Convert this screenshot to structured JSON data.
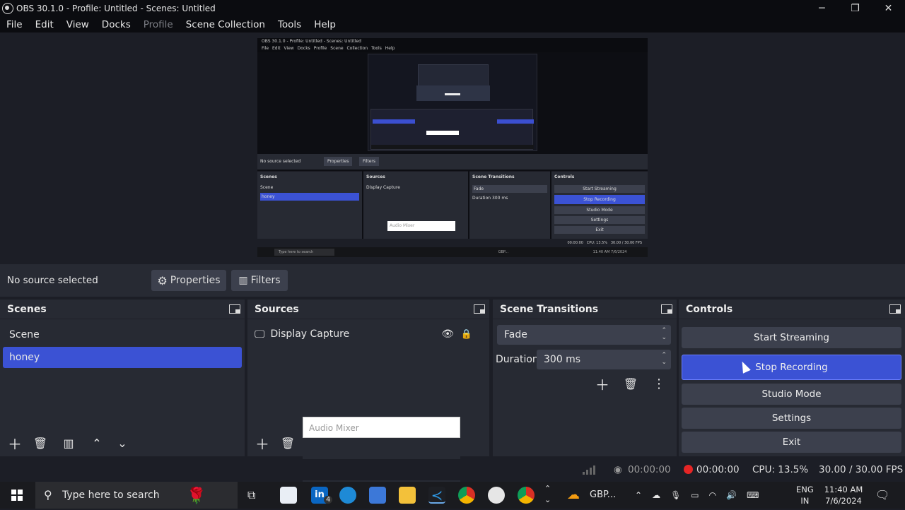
{
  "window": {
    "title": "OBS 30.1.0 - Profile: Untitled - Scenes: Untitled",
    "minimize": "─",
    "restore": "❐",
    "close": "✕"
  },
  "menu": [
    "File",
    "Edit",
    "View",
    "Docks",
    "Profile",
    "Scene Collection",
    "Tools",
    "Help"
  ],
  "preview": {
    "mini_title": "OBS 30.1.0 - Profile: Untitled - Scenes: Untitled",
    "mini_menu": "File Edit View Docks Profile Scene Collection Tools Help",
    "mini_nosrc": "No source selected",
    "mini_properties": "Properties",
    "mini_filters": "Filters",
    "mini_scenes": "Scenes",
    "mini_scene1": "Scene",
    "mini_scene2": "honey",
    "mini_sources": "Sources",
    "mini_source1": "Display Capture",
    "mini_audio": "Audio Mixer",
    "mini_transitions": "Scene Transitions",
    "mini_fade": "Fade",
    "mini_duration": "Duration",
    "mini_ms": "300 ms",
    "mini_controls": "Controls",
    "mini_ctrl1": "Start Streaming",
    "mini_ctrl2": "Stop Recording",
    "mini_ctrl3": "Studio Mode",
    "mini_ctrl4": "Settings",
    "mini_ctrl5": "Exit",
    "mini_time": "00:00:00",
    "mini_cpu": "CPU: 13.5%",
    "mini_fps": "30.00 / 30.00 FPS",
    "mini_search": "Type here to search",
    "mini_gbp": "GBP...",
    "mini_clock_time": "11:40 AM",
    "mini_clock_date": "7/6/2024"
  },
  "context": {
    "no_source": "No source selected",
    "properties": "Properties",
    "filters": "Filters"
  },
  "scenes": {
    "title": "Scenes",
    "items": [
      "Scene",
      "honey"
    ],
    "selected": "honey"
  },
  "sources": {
    "title": "Sources",
    "items": [
      {
        "label": "Display Capture"
      }
    ]
  },
  "audio_mixer": {
    "title": "Audio Mixer"
  },
  "transitions": {
    "title": "Scene Transitions",
    "transition": "Fade",
    "duration_label": "Duration",
    "duration_value": "300 ms"
  },
  "controls": {
    "title": "Controls",
    "start_streaming": "Start Streaming",
    "stop_recording": "Stop Recording",
    "studio_mode": "Studio Mode",
    "settings": "Settings",
    "exit": "Exit"
  },
  "status": {
    "stream_time": "00:00:00",
    "record_time": "00:00:00",
    "cpu": "CPU: 13.5%",
    "fps": "30.00 / 30.00 FPS"
  },
  "taskbar": {
    "search_placeholder": "Type here to search",
    "linkedin_badge": "4",
    "weather": "GBP...",
    "lang1": "ENG",
    "lang2": "IN",
    "time": "11:40 AM",
    "date": "7/6/2024"
  },
  "colors": {
    "accent": "#3b52d4",
    "record": "#e52525",
    "panel": "#272a33",
    "background": "#1c1e26"
  }
}
